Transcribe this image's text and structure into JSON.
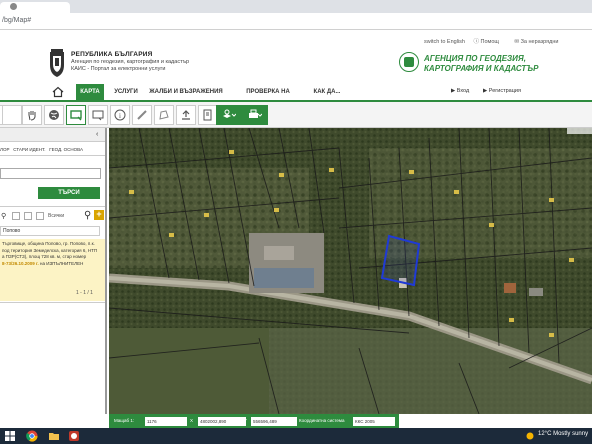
{
  "browser": {
    "url": "/bg/Map#"
  },
  "header": {
    "republic": "РЕПУБЛИКА БЪЛГАРИЯ",
    "agency_line": "Агенция по геодезия, картография и кадастър",
    "portal_line": "КАИС - Портал за електронни услуги",
    "links": [
      "switch to English",
      "Помощ",
      "За неразрядни"
    ],
    "agency_name_1": "АГЕНЦИЯ ПО ГЕОДЕЗИЯ,",
    "agency_name_2": "КАРТОГРАФИЯ И КАДАСТЪР"
  },
  "nav": {
    "items": [
      "КАРТА",
      "УСЛУГИ",
      "ЖАЛБИ И ВЪЗРАЖЕНИЯ",
      "ПРОВЕРКА НА СТАТУС",
      "КАК ДА..."
    ],
    "login": "Вход",
    "register": "Регистрация"
  },
  "left_panel": {
    "tabs": [
      "ЛОР",
      "СТАРИ ИДЕНТ.",
      "ГЕОД. ОСНОВА"
    ],
    "search_button": "ТЪРСИ",
    "all_label": "Всички",
    "place": "Попово",
    "result": {
      "line1": "Търговище, община Попово, гр. Попово, п.к.",
      "line2": "под територия Земеделска, категория 6, НТП",
      "line3": "а ПЗР(СТЗ), площ 728 кв. м, стар номер",
      "date": "8-73/26.10.2009 г.",
      "date_tail": "на ИЗПЪЛНИТЕЛЕН"
    },
    "pager": "1 - 1 / 1"
  },
  "statusbar": {
    "scale_label": "Мащаб 1:",
    "scale": "1176",
    "x_label": "X",
    "x": "4802002,890",
    "y_label": "Y",
    "y": "556596,489",
    "crs_label": "Координатна система",
    "crs": "ККС 2005"
  },
  "taskbar": {
    "weather": "12°C  Mostly sunny"
  }
}
